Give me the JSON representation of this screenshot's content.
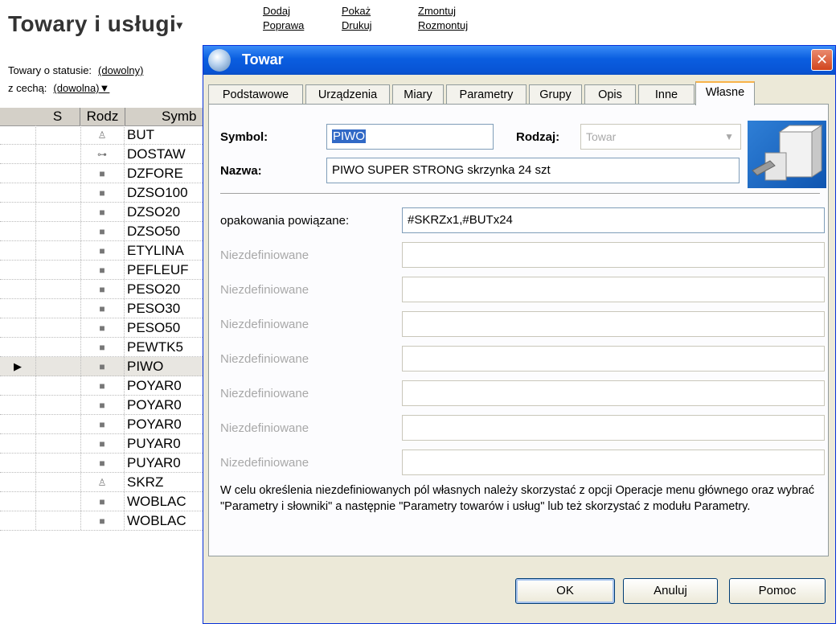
{
  "app": {
    "title": "Towary i usługi",
    "links": [
      "Dodaj",
      "Poprawa",
      "Pokaż",
      "Drukuj",
      "Zmontuj",
      "Rozmontuj"
    ],
    "status_label": "Towary o statusie:",
    "status_value": "(dowolny)",
    "feature_label": "z cechą:",
    "feature_value": "(dowolna)▼"
  },
  "grid": {
    "headers": [
      "S",
      "Rodz",
      "Symb"
    ],
    "rows": [
      {
        "type": "bottle",
        "symbol": "BUT"
      },
      {
        "type": "service",
        "symbol": "DOSTAW"
      },
      {
        "type": "item",
        "symbol": "DZFORE"
      },
      {
        "type": "item",
        "symbol": "DZSO100"
      },
      {
        "type": "item",
        "symbol": "DZSO20"
      },
      {
        "type": "item",
        "symbol": "DZSO50"
      },
      {
        "type": "item",
        "symbol": "ETYLINA"
      },
      {
        "type": "item",
        "symbol": "PEFLEUF"
      },
      {
        "type": "item",
        "symbol": "PESO20"
      },
      {
        "type": "item",
        "symbol": "PESO30"
      },
      {
        "type": "item",
        "symbol": "PESO50"
      },
      {
        "type": "item",
        "symbol": "PEWTK5"
      },
      {
        "type": "item",
        "symbol": "PIWO",
        "selected": true
      },
      {
        "type": "item",
        "symbol": "POYAR0"
      },
      {
        "type": "item",
        "symbol": "POYAR0"
      },
      {
        "type": "item",
        "symbol": "POYAR0"
      },
      {
        "type": "item",
        "symbol": "PUYAR0"
      },
      {
        "type": "item",
        "symbol": "PUYAR0"
      },
      {
        "type": "bottle",
        "symbol": "SKRZ"
      },
      {
        "type": "item",
        "symbol": "WOBLAC"
      },
      {
        "type": "item",
        "symbol": "WOBLAC"
      }
    ]
  },
  "dialog": {
    "title": "Towar",
    "close_icon": "close-icon",
    "tabs": [
      "Podstawowe",
      "Urządzenia",
      "Miary",
      "Parametry",
      "Grupy",
      "Opis",
      "Inne",
      "Własne"
    ],
    "active_tab": "Własne",
    "symbol_label": "Symbol:",
    "symbol_value": "PIWO",
    "rodzaj_label": "Rodzaj:",
    "rodzaj_value": "Towar",
    "nazwa_label": "Nazwa:",
    "nazwa_value": "PIWO SUPER STRONG skrzynka 24 szt",
    "custom_fields": [
      {
        "label": "opakowania powiązane:",
        "value": "#SKRZx1,#BUTx24",
        "enabled": true
      },
      {
        "label": "Niezdefiniowane",
        "value": "",
        "enabled": false
      },
      {
        "label": "Niezdefiniowane",
        "value": "",
        "enabled": false
      },
      {
        "label": "Niezdefiniowane",
        "value": "",
        "enabled": false
      },
      {
        "label": "Niezdefiniowane",
        "value": "",
        "enabled": false
      },
      {
        "label": "Niezdefiniowane",
        "value": "",
        "enabled": false
      },
      {
        "label": "Niezdefiniowane",
        "value": "",
        "enabled": false
      },
      {
        "label": "Nizedefiniowane",
        "value": "",
        "enabled": false
      }
    ],
    "note": "W celu określenia niezdefiniowanych pól własnych należy skorzystać z opcji Operacje menu głównego oraz wybrać \"Parametry i słowniki\" a następnie \"Parametry towarów i usług\" lub też skorzystać z modułu Parametry.",
    "buttons": {
      "ok": "OK",
      "cancel": "Anuluj",
      "help": "Pomoc"
    }
  }
}
